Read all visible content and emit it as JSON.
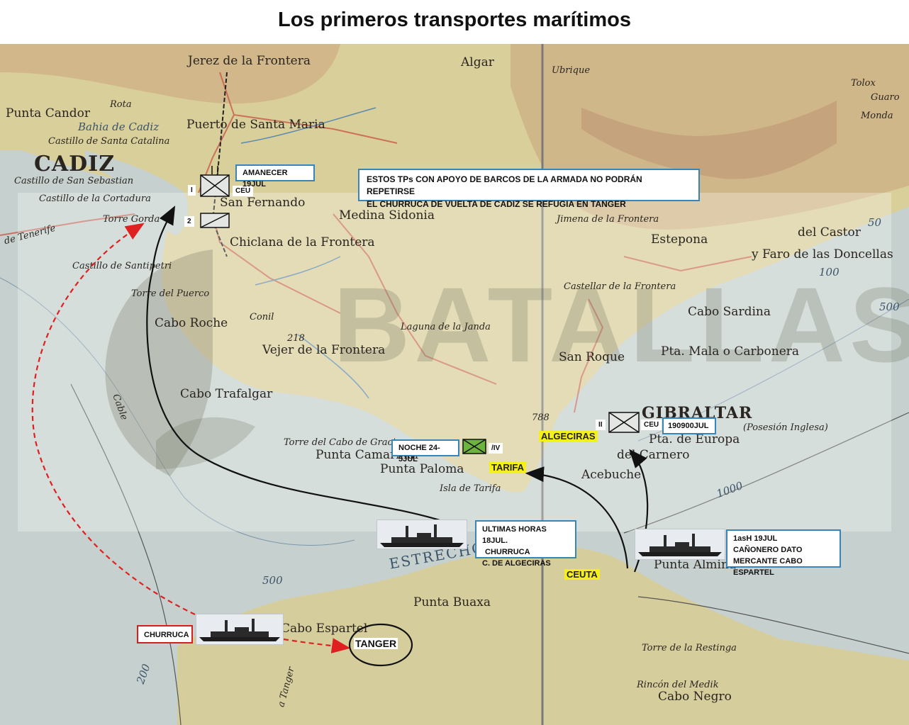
{
  "title": "Los primeros transportes marítimos",
  "colors": {
    "route_black": "#111111",
    "route_red": "#e02020",
    "box_blue": "#3a85b8",
    "highlight": "#f5ef1e",
    "unit_green": "#6cb33f"
  },
  "map_labels": {
    "jerez": "Jerez de la Frontera",
    "puerto": "Puerto de Santa Maria",
    "cadiz": "CADIZ",
    "punta_candor": "Punta Candor",
    "rota": "Rota",
    "bahia": "Bahia de Cadiz",
    "castillo_catalina": "Castillo de Santa Catalina",
    "castillo_sebastian": "Castillo de San Sebastian",
    "castillo_cortadura": "Castillo de la Cortadura",
    "torre_gorda": "Torre Gorda",
    "de_tenerife": "de Tenerife",
    "san_fernando": "San Fernando",
    "medina": "Medina Sidonia",
    "chiclana": "Chiclana de la Frontera",
    "castillo_santipetri": "Castillo de Santipetri",
    "torre_puerco": "Torre del Puerco",
    "cabo_roche": "Cabo Roche",
    "conil": "Conil",
    "vejer": "Vejer de la Frontera",
    "laguna": "Laguna de la Janda",
    "cabo_trafalgar": "Cabo Trafalgar",
    "cable": "Cable",
    "torre_gracia": "Torre del Cabo de Gracia",
    "punta_camarinal": "Punta Camarinal",
    "punta_paloma": "Punta Paloma",
    "isla_tarifa": "Isla de Tarifa",
    "estrecho": "ESTRECHO",
    "punta_buaxa": "Punta Buaxa",
    "cabo_espartel": "Cabo Espartel",
    "a_tanger": "a Tanger",
    "algar": "Algar",
    "ubrique": "Ubrique",
    "jimena": "Jimena de la Frontera",
    "estepona": "Estepona",
    "castellar": "Castellar de la Frontera",
    "san_roque": "San Roque",
    "cabo_sardina": "Cabo Sardina",
    "punta_carbonera": "Pta. Mala o Carbonera",
    "del_castor": "del Castor",
    "faro": "y Faro de las Doncellas",
    "gibraltar": "GIBRALTAR",
    "posesion": "(Posesión Inglesa)",
    "europa": "Pta. de Europa",
    "carnero": "del Carnero",
    "acebuche": "Acebuche",
    "punta_almina": "Punta Almina",
    "torre_restinga": "Torre de la Restinga",
    "rincon_medik": "Rincón del Medik",
    "cabo_negro": "Cabo Negro",
    "tolox": "Tolox",
    "guaro": "Guaro",
    "monda": "Monda",
    "d_500": "500",
    "d_1000": "1000",
    "d_100": "100",
    "d_200": "200",
    "d_50": "50",
    "d_218": "218",
    "d_788": "788",
    "watermark": "BATALLAS"
  },
  "annotations": {
    "amanecer": "AMANECER 19JUL",
    "unit1_num": "I",
    "unit1_ceu": "CEU",
    "unit2_num": "2",
    "note_line1": "ESTOS TPs CON APOYO DE BARCOS DE LA ARMADA NO PODRÁN REPETIRSE",
    "note_line2": "EL CHURRUCA DE VUELTA DE CADIZ SE REFUGIA EN TANGER",
    "noche": "NOCHE 24-5JUL",
    "iv": "/IV",
    "unit3_num": "II",
    "unit3_ceu": "CEU",
    "time_190900": "190900JUL",
    "algeciras": "ALGECIRAS",
    "tarifa": "TARIFA",
    "ceuta": "CEUTA",
    "ultimas_line1": "ULTIMAS HORAS 18JUL.",
    "ultimas_line2": "CHURRUCA",
    "ultimas_line3": "C. DE ALGECIRAS",
    "dato_line1": "1asH 19JUL",
    "dato_line2": "CAÑONERO DATO",
    "dato_line3": "MERCANTE CABO ESPARTEL",
    "churruca": "CHURRUCA",
    "tanger": "TANGER"
  }
}
